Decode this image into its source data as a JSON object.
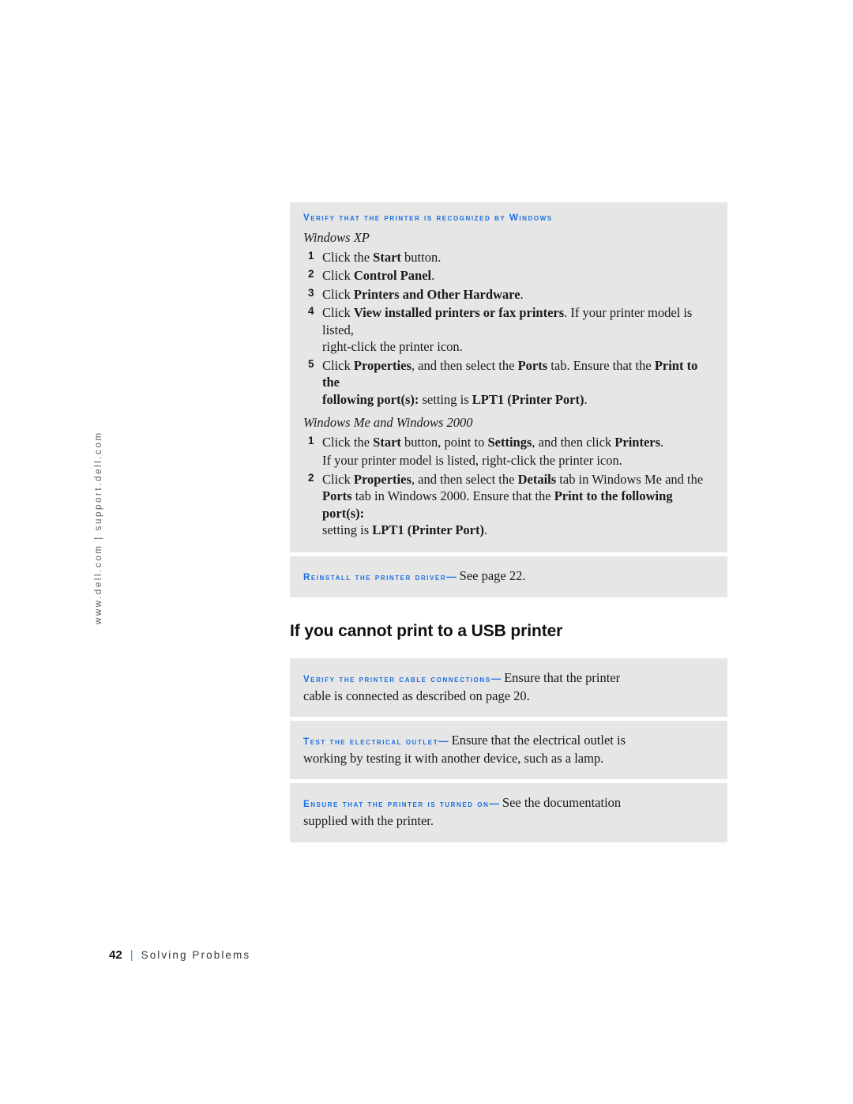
{
  "page": {
    "side_url": "www.dell.com | support.dell.com",
    "footer": {
      "page_number": "42",
      "separator": "|",
      "chapter_title": "Solving Problems"
    },
    "accent_color": "#1a6fe0",
    "box_background": "#e6e6e6"
  },
  "tips": {
    "verify_recognized": {
      "heading": "Verify that the printer is recognized by Windows",
      "os_xp_label": "Windows XP",
      "xp_steps": [
        {
          "num": "1",
          "pre": "Click the ",
          "bold": "Start",
          "post": " button."
        },
        {
          "num": "2",
          "pre": "Click ",
          "bold": "Control Panel",
          "post": "."
        },
        {
          "num": "3",
          "pre": "Click ",
          "bold": "Printers and Other Hardware",
          "post": "."
        }
      ],
      "xp_step4_num": "4",
      "xp_step4_pre": "Click ",
      "xp_step4_bold": "View installed printers or fax printers",
      "xp_step4_post": ". If your printer model is listed,",
      "xp_step4_line2": "right-click the printer icon.",
      "xp_step5_num": "5",
      "xp_step5_a": "Click ",
      "xp_step5_b1": "Properties",
      "xp_step5_c": ", and then select the ",
      "xp_step5_b2": "Ports",
      "xp_step5_d": " tab. Ensure that the ",
      "xp_step5_b3": "Print to the",
      "xp_step5_l2_b1": "following port(s):",
      "xp_step5_l2_mid": " setting is ",
      "xp_step5_l2_b2": "LPT1 (Printer Port)",
      "xp_step5_l2_end": ".",
      "os_me2k_label": "Windows Me and Windows 2000",
      "me_step1_num": "1",
      "me_step1_a": "Click the ",
      "me_step1_b1": "Start",
      "me_step1_c": " button, point to ",
      "me_step1_b2": "Settings",
      "me_step1_d": ", and then click ",
      "me_step1_b3": "Printers",
      "me_step1_e": ".",
      "me_step1_cont": "If your printer model is listed, right-click the printer icon.",
      "me_step2_num": "2",
      "me_step2_a": "Click ",
      "me_step2_b1": "Properties",
      "me_step2_c": ", and then select the ",
      "me_step2_b2": "Details",
      "me_step2_d": " tab in Windows Me and the",
      "me_step2_l2_b1": "Ports",
      "me_step2_l2_a": " tab in Windows 2000. Ensure that the ",
      "me_step2_l2_b2": "Print to the following port(s):",
      "me_step2_l3_a": "setting is ",
      "me_step2_l3_b": "LPT1 (Printer Port)",
      "me_step2_l3_c": "."
    },
    "reinstall_driver": {
      "heading": "Reinstall the printer driver",
      "dash": "—",
      "body": "See page 22."
    },
    "verify_cable": {
      "heading": "Verify the printer cable connections",
      "dash": "—",
      "body": "Ensure that the printer",
      "body_line2": "cable is connected as described on page 20."
    },
    "test_outlet": {
      "heading": "Test the electrical outlet",
      "dash": "—",
      "body": "Ensure that the electrical outlet is",
      "body_line2": "working by testing it with another device, such as a lamp."
    },
    "printer_on": {
      "heading": "Ensure that the printer is turned on",
      "dash": "—",
      "body": "See the documentation",
      "body_line2": "supplied with the printer."
    }
  },
  "section": {
    "usb_heading": "If you cannot print to a USB printer"
  }
}
